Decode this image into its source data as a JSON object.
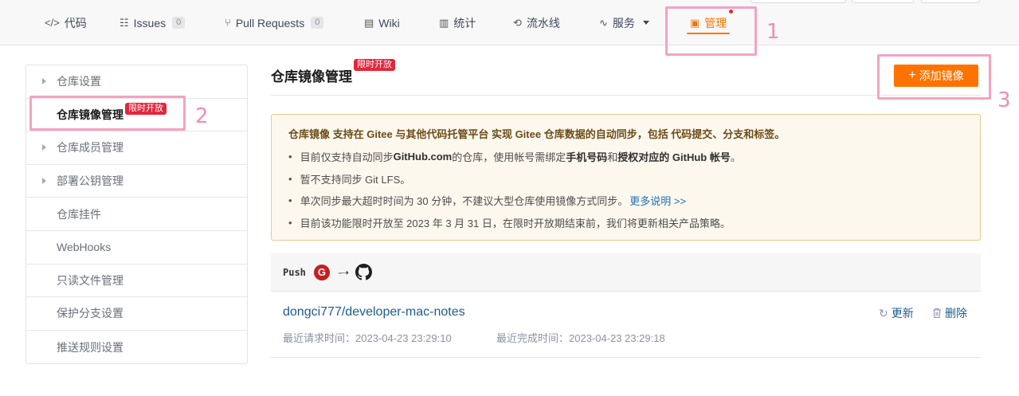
{
  "tabs": [
    {
      "icon": "code-icon",
      "glyph": "</>",
      "label": "代码"
    },
    {
      "icon": "issues-icon",
      "glyph": "☷",
      "label": "Issues",
      "count": "0"
    },
    {
      "icon": "pull-request-icon",
      "glyph": "⑂",
      "label": "Pull Requests",
      "count": "0"
    },
    {
      "icon": "wiki-icon",
      "glyph": "▤",
      "label": "Wiki"
    },
    {
      "icon": "stats-icon",
      "glyph": "▥",
      "label": "统计"
    },
    {
      "icon": "pipeline-icon",
      "glyph": "⟲",
      "label": "流水线"
    },
    {
      "icon": "services-icon",
      "glyph": "∿",
      "label": "服务"
    },
    {
      "icon": "manage-icon",
      "glyph": "▣",
      "label": "管理"
    }
  ],
  "annotations": {
    "one": "1",
    "two": "2",
    "three": "3"
  },
  "sidebar": {
    "items": [
      {
        "label": "仓库设置",
        "expandable": true
      },
      {
        "label": "仓库镜像管理",
        "badge": "限时开放",
        "active": true
      },
      {
        "label": "仓库成员管理",
        "expandable": true
      },
      {
        "label": "部署公钥管理",
        "expandable": true
      },
      {
        "label": "仓库挂件"
      },
      {
        "label": "WebHooks"
      },
      {
        "label": "只读文件管理"
      },
      {
        "label": "保护分支设置"
      },
      {
        "label": "推送规则设置"
      }
    ]
  },
  "main": {
    "title": "仓库镜像管理",
    "title_badge": "限时开放",
    "add_button": "添加镜像",
    "notice": {
      "head": "仓库镜像 支持在 Gitee 与其他代码托管平台 实现 Gitee 仓库数据的自动同步，包括 代码提交、分支和标签。",
      "lines": {
        "l1_a": "目前仅支持自动同步 ",
        "l1_b": "GitHub.com",
        "l1_c": " 的仓库，使用帐号需绑定 ",
        "l1_d": "手机号码",
        "l1_e": " 和 ",
        "l1_f": "授权对应的 GitHub 帐号",
        "l1_g": "。",
        "l2": "暂不支持同步 Git LFS。",
        "l3": "单次同步最大超时时间为 30 分钟，不建议大型仓库使用镜像方式同步。",
        "l3_link": "更多说明 >>",
        "l4": "目前该功能限时开放至 2023 年 3 月 31 日，在限时开放期结束前，我们将更新相关产品策略。"
      }
    },
    "push": {
      "label": "Push",
      "gitee_glyph": "G",
      "arrow": "··➝"
    },
    "mirror": {
      "repo": "dongci777/developer-mac-notes",
      "last_request": "最近请求时间：2023-04-23 23:29:10",
      "last_complete": "最近完成时间：2023-04-23 23:29:18",
      "update": "更新",
      "delete": "删除"
    }
  },
  "colors": {
    "accent": "#fe7300",
    "badge": "#e4263b",
    "link": "#1e5c8e",
    "annotation": "#f4a3c2"
  }
}
